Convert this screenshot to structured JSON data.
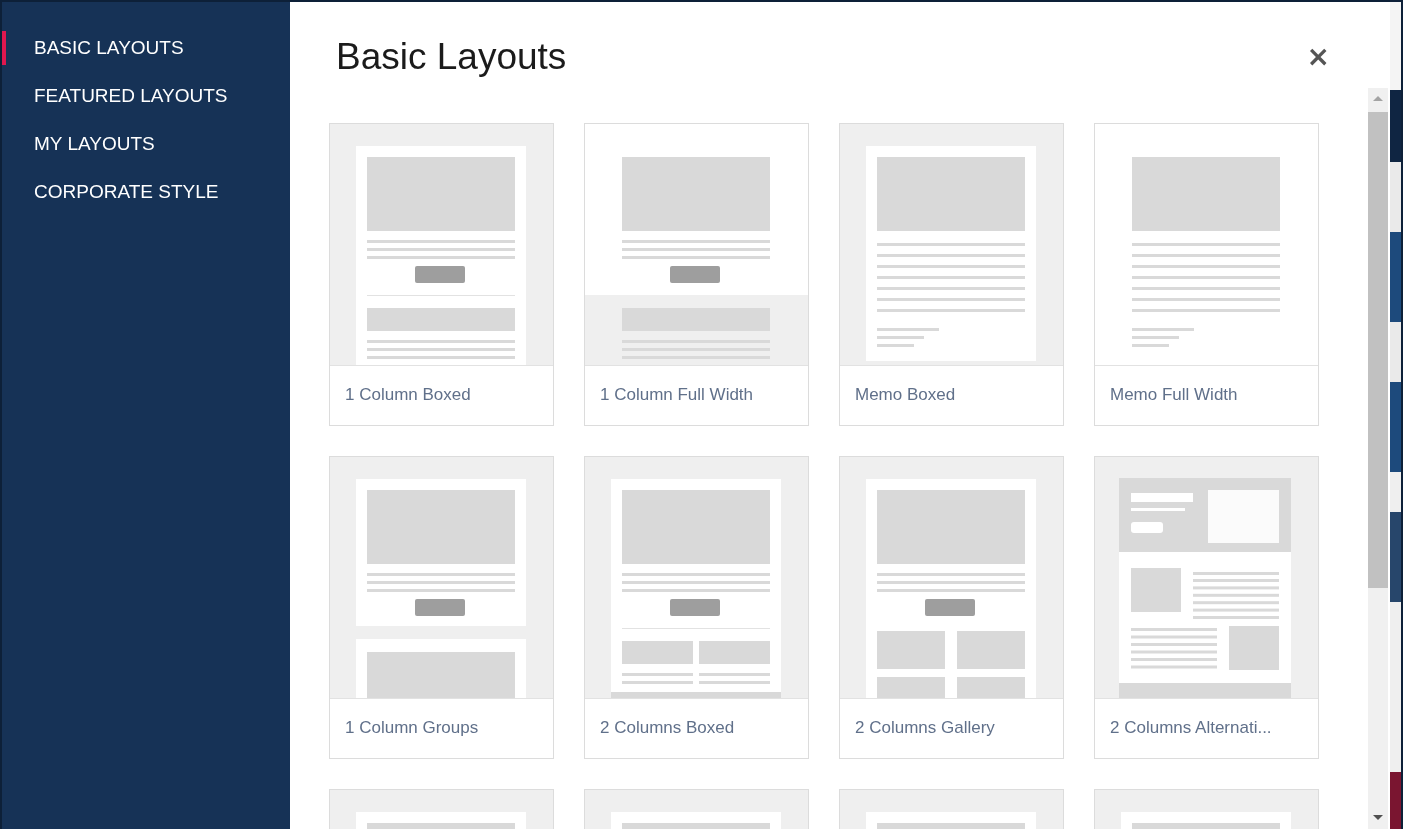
{
  "sidebar": {
    "items": [
      {
        "label": "BASIC LAYOUTS",
        "selected": true
      },
      {
        "label": "FEATURED LAYOUTS",
        "selected": false
      },
      {
        "label": "MY LAYOUTS",
        "selected": false
      },
      {
        "label": "CORPORATE STYLE",
        "selected": false
      }
    ]
  },
  "dialog": {
    "title": "Basic Layouts",
    "close": "×"
  },
  "layouts": [
    {
      "kind": "boxed",
      "label": "1 Column Boxed"
    },
    {
      "kind": "full-width",
      "label": "1 Column Full Width"
    },
    {
      "kind": "memo-boxed",
      "label": "Memo Boxed"
    },
    {
      "kind": "memo-full",
      "label": "Memo Full Width"
    },
    {
      "kind": "groups",
      "label": "1 Column Groups"
    },
    {
      "kind": "two-boxed",
      "label": "2 Columns Boxed"
    },
    {
      "kind": "gallery",
      "label": "2 Columns Gallery"
    },
    {
      "kind": "alternating",
      "label": "2 Columns Alternati..."
    },
    {
      "kind": "boxed"
    },
    {
      "kind": "boxed"
    },
    {
      "kind": "boxed"
    },
    {
      "kind": "boxed"
    }
  ]
}
